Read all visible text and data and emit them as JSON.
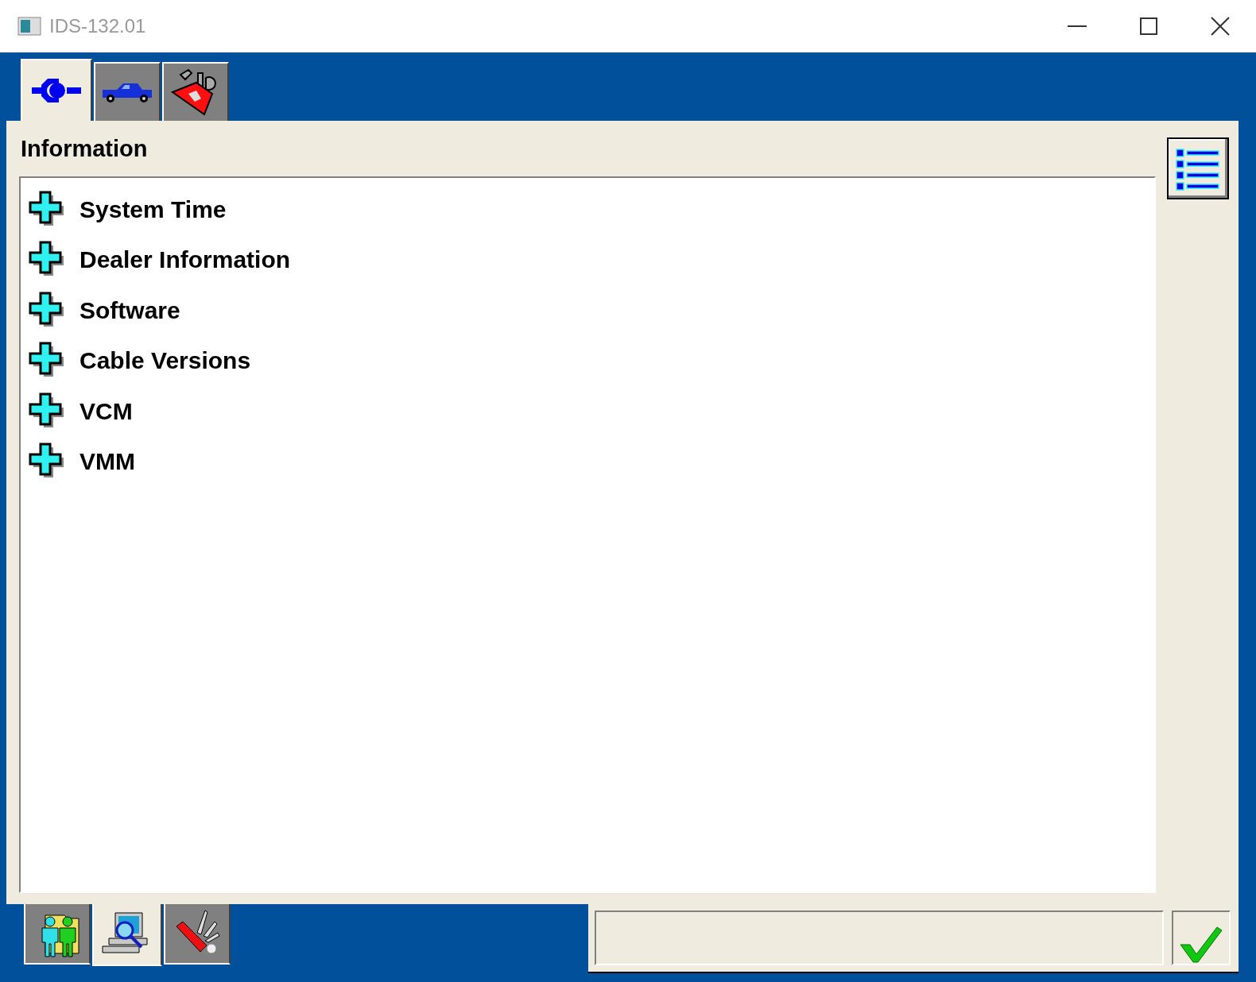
{
  "window": {
    "title": "IDS-132.01"
  },
  "top_tabs": [
    {
      "kind": "connector",
      "selected": true
    },
    {
      "kind": "vehicle",
      "selected": false
    },
    {
      "kind": "toolbox",
      "selected": false
    }
  ],
  "panel": {
    "title": "Information"
  },
  "tree": [
    {
      "label": "System Time",
      "expanded": false
    },
    {
      "label": "Dealer Information",
      "expanded": false
    },
    {
      "label": "Software",
      "expanded": false
    },
    {
      "label": "Cable Versions",
      "expanded": false
    },
    {
      "label": "VCM",
      "expanded": false
    },
    {
      "label": "VMM",
      "expanded": false
    }
  ],
  "bottom_tabs": [
    {
      "kind": "people",
      "selected": false
    },
    {
      "kind": "computer",
      "selected": true
    },
    {
      "kind": "knife",
      "selected": false
    }
  ]
}
